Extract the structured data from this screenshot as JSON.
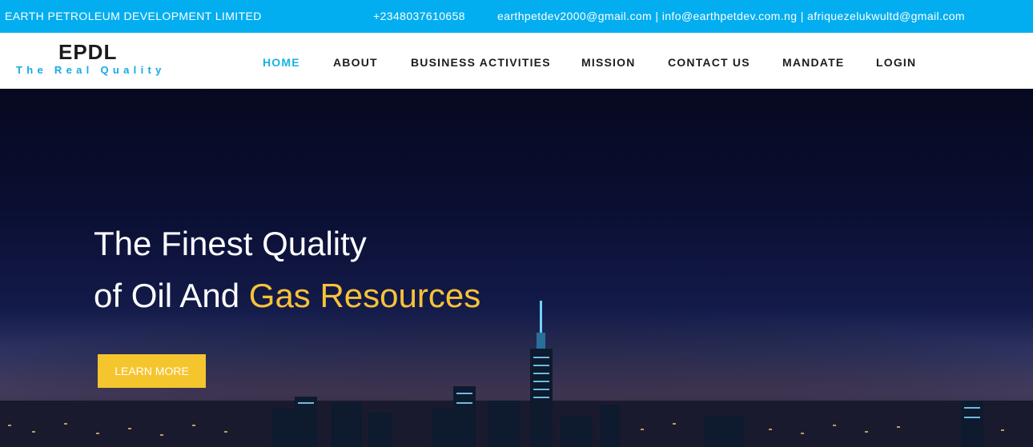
{
  "topbar": {
    "company": "EARTH PETROLEUM DEVELOPMENT LIMITED",
    "phone": "+2348037610658",
    "emails": "earthpetdev2000@gmail.com | info@earthpetdev.com.ng | afriquezelukwultd@gmail.com"
  },
  "logo": {
    "title": "EPDL",
    "tagline": "The Real Quality"
  },
  "nav": {
    "items": [
      "HOME",
      "ABOUT",
      "BUSINESS ACTIVITIES",
      "MISSION",
      "CONTACT US",
      "MANDATE",
      "LOGIN"
    ],
    "active": "HOME"
  },
  "hero": {
    "line1": "The Finest Quality",
    "line2_prefix": "of Oil And ",
    "line2_accent": "Gas Resources",
    "button": "LEARN MORE"
  },
  "colors": {
    "topbar": "#02aef0",
    "nav_active": "#16b2e8",
    "accent": "#f7c23a",
    "button": "#f5c52e"
  }
}
